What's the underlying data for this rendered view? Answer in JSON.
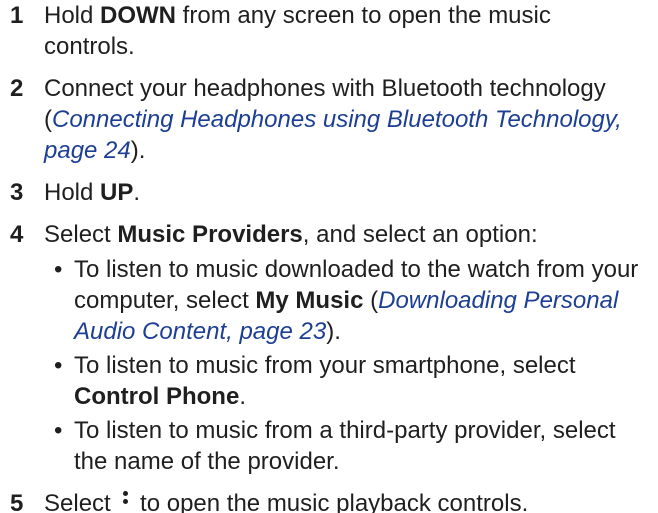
{
  "steps": [
    {
      "num": "1",
      "t1": "Hold ",
      "b1": "DOWN",
      "t2": " from any screen to open the music controls."
    },
    {
      "num": "2",
      "t1": "Connect your headphones with Bluetooth technology (",
      "link": "Connecting Headphones using Bluetooth Technology, page 24",
      "t2": ")."
    },
    {
      "num": "3",
      "t1": "Hold ",
      "b1": "UP",
      "t2": "."
    },
    {
      "num": "4",
      "t1": "Select ",
      "b1": "Music Providers",
      "t2": ", and select an option:",
      "bullets": [
        {
          "t1": "To listen to music downloaded to the watch from your computer, select ",
          "b1": "My Music",
          "t2": " (",
          "link": "Downloading Personal Audio Content, page 23",
          "t3": ")."
        },
        {
          "t1": "To listen to music from your smartphone, select ",
          "b1": "Control Phone",
          "t2": "."
        },
        {
          "t1": "To listen to music from a third-party provider, select the name of the provider."
        }
      ]
    },
    {
      "num": "5",
      "t1": "Select ",
      "icon": "menu-icon",
      "t2": " to open the music playback controls."
    }
  ],
  "bullet_glyph": "•",
  "colors": {
    "text": "#1f1f1f",
    "link": "#1c3f94"
  }
}
